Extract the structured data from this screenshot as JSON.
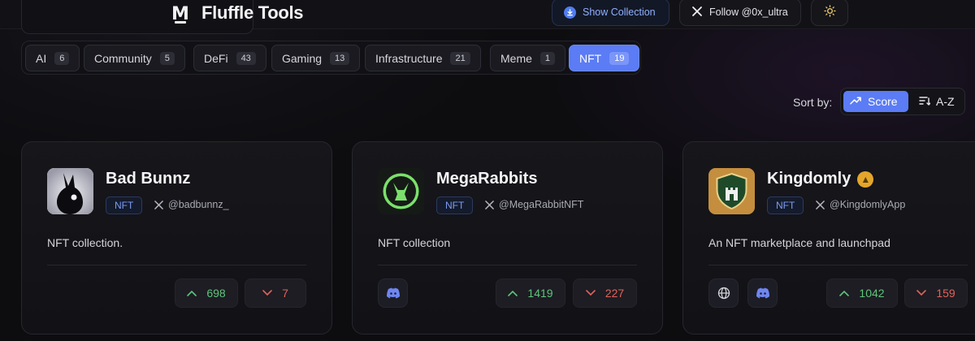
{
  "header": {
    "brand": "Fluffle Tools",
    "show_collection": "Show Collection",
    "follow": "Follow @0x_ultra"
  },
  "filters": [
    {
      "label": "AI",
      "count": "6"
    },
    {
      "label": "Community",
      "count": "5"
    },
    {
      "label": "DeFi",
      "count": "43"
    },
    {
      "label": "Gaming",
      "count": "13"
    },
    {
      "label": "Infrastructure",
      "count": "21"
    },
    {
      "label": "Meme",
      "count": "1"
    },
    {
      "label": "NFT",
      "count": "19"
    }
  ],
  "sort": {
    "label": "Sort by:",
    "score": "Score",
    "az": "A-Z"
  },
  "cards": [
    {
      "name": "Bad Bunnz",
      "tag": "NFT",
      "handle": "@badbunnz_",
      "description": "NFT collection.",
      "up": "698",
      "down": "7"
    },
    {
      "name": "MegaRabbits",
      "tag": "NFT",
      "handle": "@MegaRabbitNFT",
      "description": "NFT collection",
      "up": "1419",
      "down": "227"
    },
    {
      "name": "Kingdomly",
      "tag": "NFT",
      "handle": "@KingdomlyApp",
      "description": "An NFT marketplace and launchpad",
      "up": "1042",
      "down": "159"
    }
  ],
  "colors": {
    "accent": "#5b7cf5",
    "upvote": "#5ec47a",
    "downvote": "#e0625a",
    "badge": "#e4a62b"
  }
}
